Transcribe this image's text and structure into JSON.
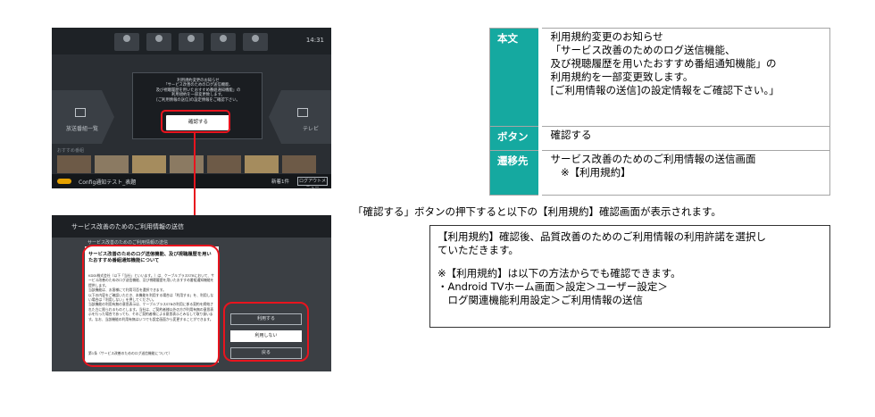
{
  "tv_home": {
    "clock": "14:31",
    "left_tile": "放送番組一覧",
    "right_tile": "テレビ",
    "row_label": "おすすめ番組",
    "status_text": "Config通知テスト_表題",
    "new_count": "新着1件",
    "menu_button": "ログアウトメニュー",
    "dialog_text": "利用規約変更のお知らせ\n「サービス改善のためのログ送信機能、\n及び視聴履歴を用いたおすすめ番組通知機能」の\n利用規約を一部変更致します。\n[ご利用情報の送信]の設定情報をご確認下さい。",
    "confirm_button": "確認する"
  },
  "tv_terms": {
    "title": "サービス改善のためのご利用情報の送信",
    "subtitle": "サービス改善のためのご利用情報の送信",
    "doc_heading": "サービス改善のためのログ送信機能、及び視聴履歴を用いたおすすめ番組通知機能について",
    "doc_body": "KDDI株式会社（以下「当社」といいます。）は、ケーブルプラスSTBにおいて、サービス改善のためのログ送信機能、及び視聴履歴を用いたおすすめ番組通知機能を提供します。\n当該機能は、お客様にて利用可否を選択できます。\n以下の内容をご確認いただき、本機能を利用する場合は「利用する」を、利用しない場合は「利用しない」を押してください。\n当該機能の利用有無の意思表示は、ケーブルプラスSTBの利用に係る契約を締結された方に限られるものとします。当社は、ご契約者様以外の方が利用有無の意思表示を行った場合であっても、そのご契約者様による意思表示とみなして取り扱います。なお、当該機能の利用有無はいつでも設定画面から変更することができます。",
    "doc_footer": "第1条（サービス改善のためのログ送信機能について）",
    "buttons": [
      "利用する",
      "利用しない",
      "戻る"
    ]
  },
  "spec": {
    "rows": [
      {
        "key": "本文",
        "value": "利用規約変更のお知らせ\n「サービス改善のためのログ送信機能、\n及び視聴履歴を用いたおすすめ番組通知機能」の\n利用規約を一部変更致します。\n[ご利用情報の送信]の設定情報をご確認下さい。」"
      },
      {
        "key": "ボタン",
        "value": "確認する"
      },
      {
        "key": "遷移先",
        "value": "サービス改善のためのご利用情報の送信画面\n　※【利用規約】"
      }
    ]
  },
  "caption": "「確認する」ボタンの押下すると以下の【利用規約】確認画面が表示されます。",
  "note": {
    "line1": "【利用規約】確認後、品質改善のためのご利用情報の利用許諾を選択し\nていただきます。",
    "line2": "※【利用規約】は以下の方法からでも確認できます。\n・Android TVホーム画面＞設定＞ユーザー設定＞\n　ログ関連機能利用設定＞ご利用情報の送信"
  },
  "colors": {
    "accent": "#15a9a0",
    "highlight": "#e8141e"
  }
}
